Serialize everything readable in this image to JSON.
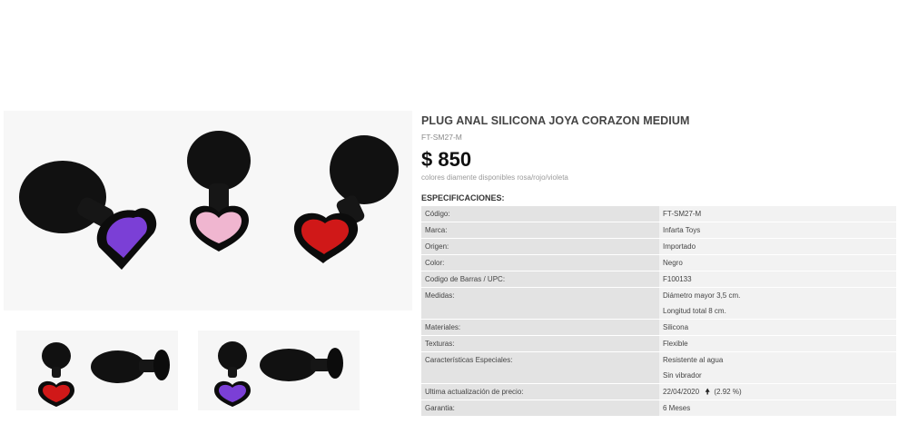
{
  "product": {
    "title": "PLUG ANAL SILICONA JOYA CORAZON MEDIUM",
    "sku": "FT-SM27-M",
    "price": "$ 850",
    "note": "colores diamente disponibles rosa/rojo/violeta",
    "specs_heading": "ESPECIFICACIONES:"
  },
  "gem_colors": {
    "violet": "#7b3fd6",
    "pink": "#f0b6d0",
    "red": "#d01818"
  },
  "specs": [
    {
      "label": "Código:",
      "values": [
        "FT-SM27-M"
      ]
    },
    {
      "label": "Marca:",
      "values": [
        "Infarta Toys"
      ]
    },
    {
      "label": "Origen:",
      "values": [
        "Importado"
      ]
    },
    {
      "label": "Color:",
      "values": [
        "Negro"
      ]
    },
    {
      "label": "Codigo de Barras / UPC:",
      "values": [
        "F100133"
      ]
    },
    {
      "label": "Medidas:",
      "values": [
        "Diámetro mayor 3,5 cm.",
        "Longitud total 8 cm."
      ]
    },
    {
      "label": "Materiales:",
      "values": [
        "Silicona"
      ]
    },
    {
      "label": "Texturas:",
      "values": [
        "Flexible"
      ]
    },
    {
      "label": "Características Especiales:",
      "values": [
        "Resistente al agua",
        "Sin vibrador"
      ]
    },
    {
      "label": "Ultima actualización de precio:",
      "values": [
        "22/04/2020"
      ],
      "change": "(2.92 %)",
      "change_icon": "arrow-up-icon"
    },
    {
      "label": "Garantia:",
      "values": [
        "6 Meses"
      ]
    }
  ]
}
